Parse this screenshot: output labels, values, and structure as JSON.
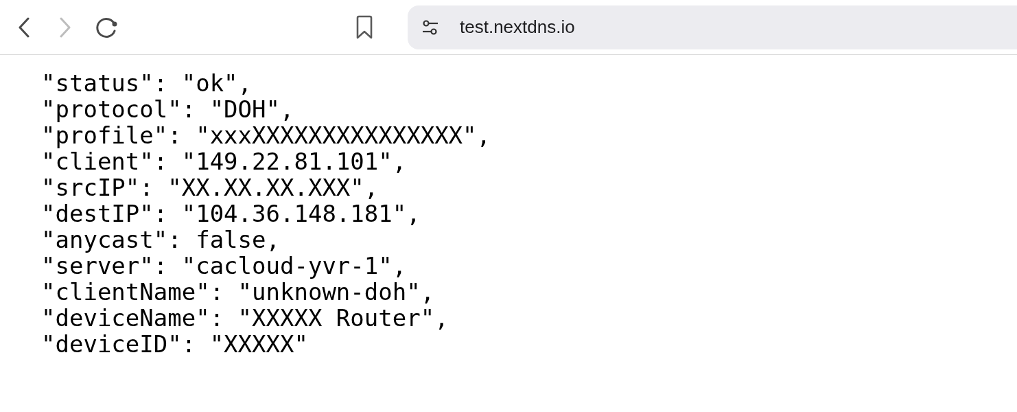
{
  "toolbar": {
    "back": {
      "disabled": false
    },
    "forward": {
      "disabled": true
    },
    "address": "test.nextdns.io"
  },
  "lines": [
    "\"status\": \"ok\",",
    "\"protocol\": \"DOH\",",
    "\"profile\": \"xxxXXXXXXXXXXXXXXX\",",
    "\"client\": \"149.22.81.101\",",
    "\"srcIP\": \"XX.XX.XX.XXX\",",
    "\"destIP\": \"104.36.148.181\",",
    "\"anycast\": false,",
    "\"server\": \"cacloud-yvr-1\",",
    "\"clientName\": \"unknown-doh\",",
    "\"deviceName\": \"XXXXX Router\",",
    "\"deviceID\": \"XXXXX\""
  ]
}
